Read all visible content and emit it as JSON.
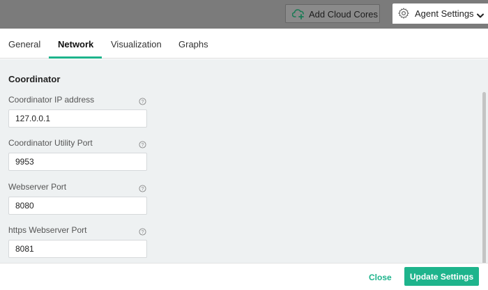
{
  "topbar": {
    "add_cloud_label": "Add Cloud Cores",
    "agent_settings_label": "Agent Settings"
  },
  "tabs": [
    {
      "label": "General"
    },
    {
      "label": "Network"
    },
    {
      "label": "Visualization"
    },
    {
      "label": "Graphs"
    }
  ],
  "active_tab": "Network",
  "section": {
    "title": "Coordinator",
    "fields": [
      {
        "label": "Coordinator IP address",
        "value": "127.0.0.1"
      },
      {
        "label": "Coordinator Utility Port",
        "value": "9953"
      },
      {
        "label": "Webserver Port",
        "value": "8080"
      },
      {
        "label": "https Webserver Port",
        "value": "8081"
      }
    ]
  },
  "footer": {
    "close_label": "Close",
    "update_label": "Update Settings"
  },
  "colors": {
    "accent": "#1eb48c",
    "overlay": "#7b7b7b",
    "content_bg": "#eef1f2"
  },
  "icons": {
    "cloud": "cloud-plus-icon",
    "gear": "gear-icon",
    "chevron": "chevron-down-icon",
    "help": "help-circle-icon"
  }
}
